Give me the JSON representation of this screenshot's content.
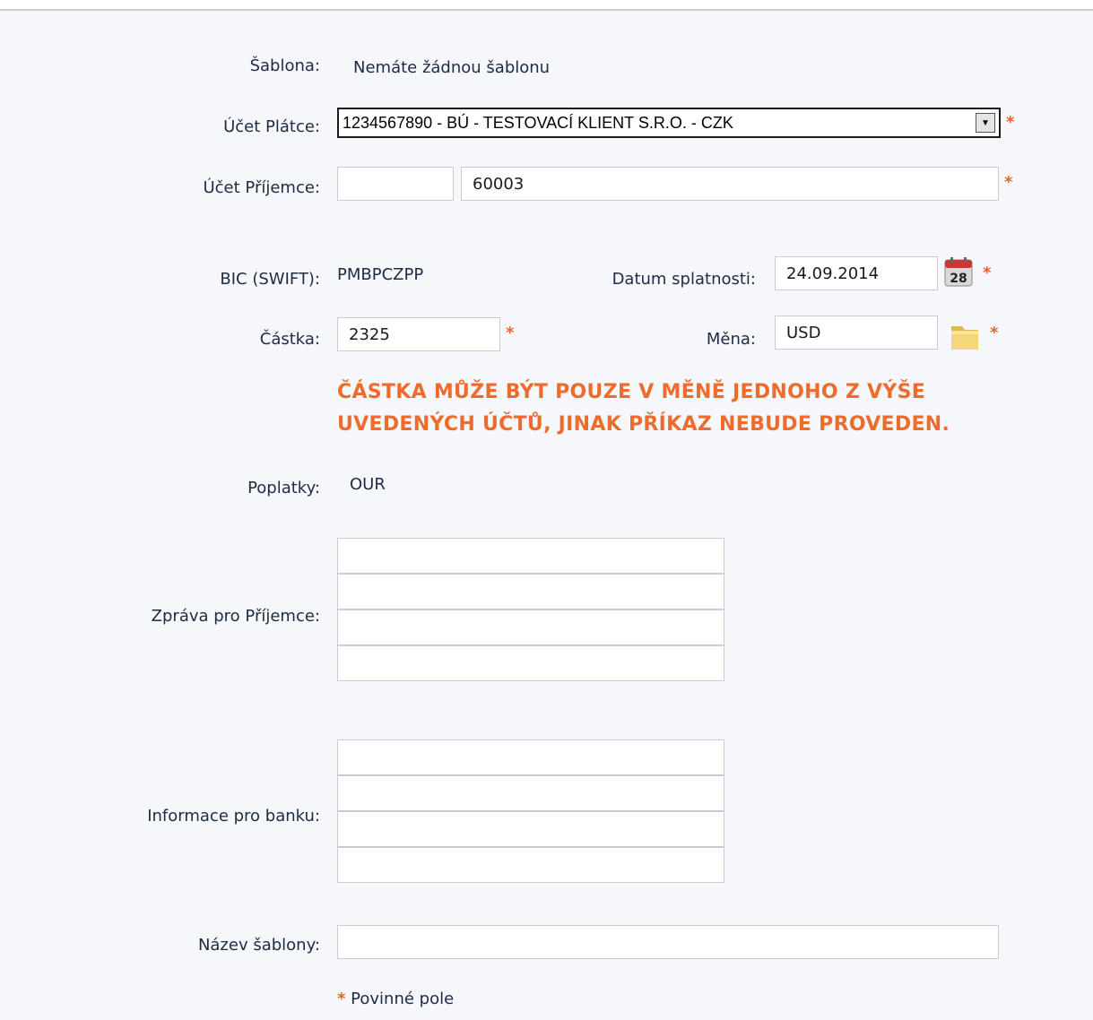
{
  "form": {
    "template_label": "Šablona:",
    "template_value": "Nemáte žádnou šablonu",
    "payer_label": "Účet Plátce:",
    "payer_value": "1234567890 - BÚ - TESTOVACÍ KLIENT S.R.O. - CZK",
    "payee_label": "Účet Příjemce:",
    "payee_prefix": "",
    "payee_number": "60003",
    "bic_label": "BIC (SWIFT):",
    "bic_value": "PMBPCZPP",
    "due_label": "Datum splatnosti:",
    "due_value": "24.09.2014",
    "calendar_day": "28",
    "amount_label": "Částka:",
    "amount_value": "2325",
    "currency_label": "Měna:",
    "currency_value": "USD",
    "warning": "ČÁSTKA MŮŽE BÝT POUZE V MĚNĚ JEDNOHO Z VÝŠE UVEDENÝCH ÚČTŮ, JINAK PŘÍKAZ NEBUDE PROVEDEN.",
    "fees_label": "Poplatky:",
    "fees_value": "OUR",
    "message_label": "Zpráva pro Příjemce:",
    "bank_info_label": "Informace pro banku:",
    "template_name_label": "Název šablony:",
    "template_name_value": "",
    "required_marker": "*",
    "required_note": "Povinné pole"
  },
  "colors": {
    "accent": "#ee6b2e",
    "label": "#1d2b44",
    "background": "#f6f7fa"
  },
  "icons": {
    "calendar": "calendar-icon",
    "folder": "folder-icon"
  }
}
